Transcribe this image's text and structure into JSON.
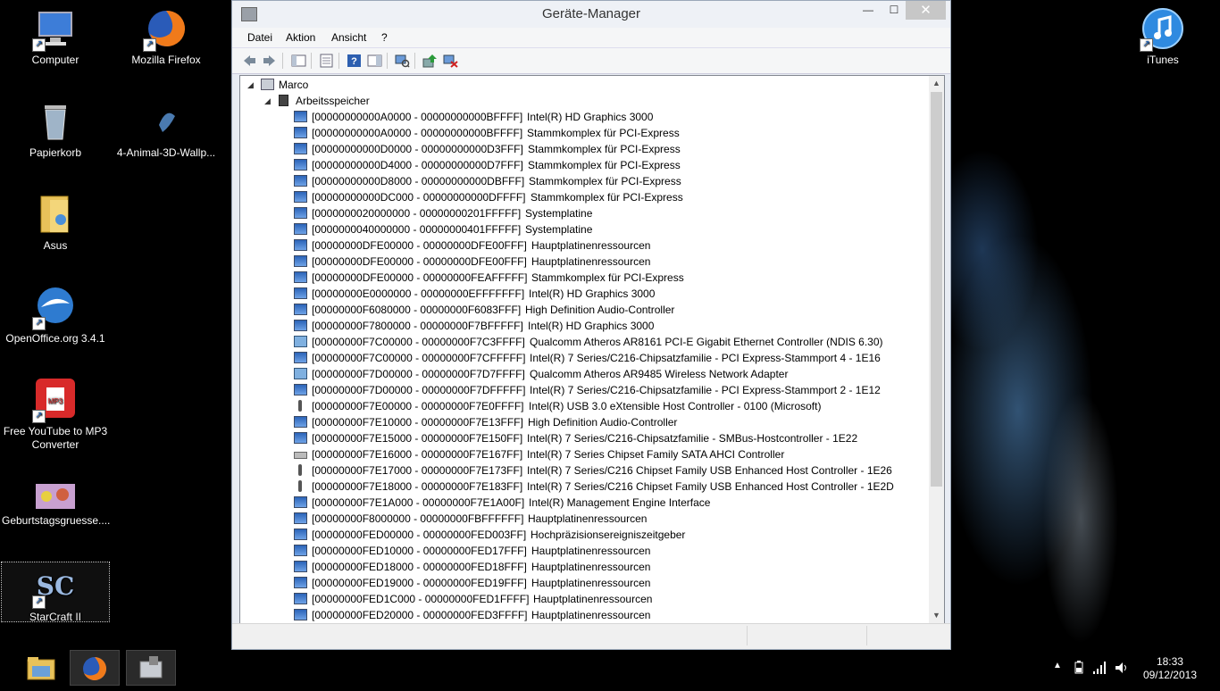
{
  "window": {
    "title": "Geräte-Manager",
    "menu": [
      "Datei",
      "Aktion",
      "Ansicht",
      "?"
    ],
    "controls": {
      "minimize": "—",
      "maximize": "☐",
      "close": "✕"
    }
  },
  "tree": {
    "root": "Marco",
    "category": "Arbeitsspeicher",
    "items": [
      {
        "range": "[00000000000A0000 - 00000000000BFFFF]",
        "name": "Intel(R) HD Graphics 3000",
        "icon": "gpu-icon"
      },
      {
        "range": "[00000000000A0000 - 00000000000BFFFF]",
        "name": "Stammkomplex für PCI-Express",
        "icon": "system-device-icon"
      },
      {
        "range": "[00000000000D0000 - 00000000000D3FFF]",
        "name": "Stammkomplex für PCI-Express",
        "icon": "system-device-icon"
      },
      {
        "range": "[00000000000D4000 - 00000000000D7FFF]",
        "name": "Stammkomplex für PCI-Express",
        "icon": "system-device-icon"
      },
      {
        "range": "[00000000000D8000 - 00000000000DBFFF]",
        "name": "Stammkomplex für PCI-Express",
        "icon": "system-device-icon"
      },
      {
        "range": "[00000000000DC000 - 00000000000DFFFF]",
        "name": "Stammkomplex für PCI-Express",
        "icon": "system-device-icon"
      },
      {
        "range": "[0000000020000000 - 00000000201FFFFF]",
        "name": "Systemplatine",
        "icon": "system-device-icon"
      },
      {
        "range": "[0000000040000000 - 00000000401FFFFF]",
        "name": "Systemplatine",
        "icon": "system-device-icon"
      },
      {
        "range": "[00000000DFE00000 - 00000000DFE00FFF]",
        "name": "Hauptplatinenressourcen",
        "icon": "system-device-icon"
      },
      {
        "range": "[00000000DFE00000 - 00000000DFE00FFF]",
        "name": "Hauptplatinenressourcen",
        "icon": "system-device-icon"
      },
      {
        "range": "[00000000DFE00000 - 00000000FEAFFFFF]",
        "name": "Stammkomplex für PCI-Express",
        "icon": "system-device-icon"
      },
      {
        "range": "[00000000E0000000 - 00000000EFFFFFFF]",
        "name": "Intel(R) HD Graphics 3000",
        "icon": "gpu-icon"
      },
      {
        "range": "[00000000F6080000 - 00000000F6083FFF]",
        "name": "High Definition Audio-Controller",
        "icon": "system-device-icon"
      },
      {
        "range": "[00000000F7800000 - 00000000F7BFFFFF]",
        "name": "Intel(R) HD Graphics 3000",
        "icon": "gpu-icon"
      },
      {
        "range": "[00000000F7C00000 - 00000000F7C3FFFF]",
        "name": "Qualcomm Atheros AR8161 PCI-E Gigabit Ethernet Controller (NDIS 6.30)",
        "icon": "network-icon"
      },
      {
        "range": "[00000000F7C00000 - 00000000F7CFFFFF]",
        "name": "Intel(R) 7 Series/C216-Chipsatzfamilie - PCI Express-Stammport 4 - 1E16",
        "icon": "system-device-icon"
      },
      {
        "range": "[00000000F7D00000 - 00000000F7D7FFFF]",
        "name": "Qualcomm Atheros AR9485 Wireless Network Adapter",
        "icon": "network-icon"
      },
      {
        "range": "[00000000F7D00000 - 00000000F7DFFFFF]",
        "name": "Intel(R) 7 Series/C216-Chipsatzfamilie - PCI Express-Stammport 2 - 1E12",
        "icon": "system-device-icon"
      },
      {
        "range": "[00000000F7E00000 - 00000000F7E0FFFF]",
        "name": "Intel(R) USB 3.0 eXtensible Host Controller - 0100 (Microsoft)",
        "icon": "usb-icon"
      },
      {
        "range": "[00000000F7E10000 - 00000000F7E13FFF]",
        "name": "High Definition Audio-Controller",
        "icon": "system-device-icon"
      },
      {
        "range": "[00000000F7E15000 - 00000000F7E150FF]",
        "name": "Intel(R) 7 Series/C216-Chipsatzfamilie - SMBus-Hostcontroller - 1E22",
        "icon": "system-device-icon"
      },
      {
        "range": "[00000000F7E16000 - 00000000F7E167FF]",
        "name": "Intel(R) 7 Series Chipset Family SATA AHCI Controller",
        "icon": "storage-controller-icon"
      },
      {
        "range": "[00000000F7E17000 - 00000000F7E173FF]",
        "name": "Intel(R) 7 Series/C216 Chipset Family USB Enhanced Host Controller - 1E26",
        "icon": "usb-icon"
      },
      {
        "range": "[00000000F7E18000 - 00000000F7E183FF]",
        "name": "Intel(R) 7 Series/C216 Chipset Family USB Enhanced Host Controller - 1E2D",
        "icon": "usb-icon"
      },
      {
        "range": "[00000000F7E1A000 - 00000000F7E1A00F]",
        "name": "Intel(R) Management Engine Interface",
        "icon": "system-device-icon"
      },
      {
        "range": "[00000000F8000000 - 00000000FBFFFFFF]",
        "name": "Hauptplatinenressourcen",
        "icon": "system-device-icon"
      },
      {
        "range": "[00000000FED00000 - 00000000FED003FF]",
        "name": "Hochpräzisionsereigniszeitgeber",
        "icon": "system-device-icon"
      },
      {
        "range": "[00000000FED10000 - 00000000FED17FFF]",
        "name": "Hauptplatinenressourcen",
        "icon": "system-device-icon"
      },
      {
        "range": "[00000000FED18000 - 00000000FED18FFF]",
        "name": "Hauptplatinenressourcen",
        "icon": "system-device-icon"
      },
      {
        "range": "[00000000FED19000 - 00000000FED19FFF]",
        "name": "Hauptplatinenressourcen",
        "icon": "system-device-icon"
      },
      {
        "range": "[00000000FED1C000 - 00000000FED1FFFF]",
        "name": "Hauptplatinenressourcen",
        "icon": "system-device-icon"
      },
      {
        "range": "[00000000FED20000 - 00000000FED3FFFF]",
        "name": "Hauptplatinenressourcen",
        "icon": "system-device-icon"
      }
    ]
  },
  "desktop": {
    "icons": [
      {
        "label": "Computer",
        "icon": "computer-icon"
      },
      {
        "label": "Mozilla Firefox",
        "icon": "firefox-icon"
      },
      {
        "label": "Papierkorb",
        "icon": "recycle-bin-icon"
      },
      {
        "label": "4-Animal-3D-Wallp...",
        "icon": "wallpaper-file-icon"
      },
      {
        "label": "Asus",
        "icon": "folder-icon"
      },
      {
        "label": "OpenOffice.org 3.4.1",
        "icon": "openoffice-icon"
      },
      {
        "label": "Free YouTube to MP3 Converter",
        "icon": "mp3-converter-icon"
      },
      {
        "label": "Geburtstagsgruesse....",
        "icon": "image-file-icon"
      },
      {
        "label": "StarCraft II",
        "icon": "starcraft-icon"
      },
      {
        "label": "iTunes",
        "icon": "itunes-icon"
      }
    ]
  },
  "taskbar": {
    "time": "18:33",
    "date": "09/12/2013"
  },
  "colors": {
    "desktop_bg": "#000000",
    "window_bg": "#e8ecf3",
    "selection": "#cce8ff"
  }
}
